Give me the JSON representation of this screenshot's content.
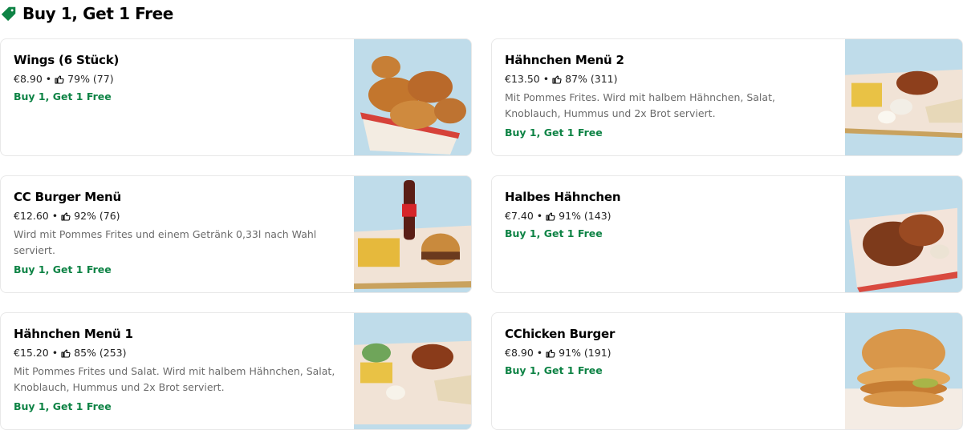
{
  "section": {
    "title": "Buy 1, Get 1 Free",
    "icon": "tag-icon",
    "accent": "#0e8345"
  },
  "items": [
    {
      "name": "Wings (6 Stück)",
      "price": "€8.90",
      "rating": "79% (77)",
      "description": "",
      "promo": "Buy 1, Get 1 Free",
      "image": "chicken-wings-photo"
    },
    {
      "name": "Hähnchen Menü 2",
      "price": "€13.50",
      "rating": "87% (311)",
      "description": "Mit Pommes Frites. Wird mit halbem Hähnchen, Salat, Knoblauch, Hummus und 2x Brot serviert.",
      "promo": "Buy 1, Get 1 Free",
      "image": "chicken-menu-photo"
    },
    {
      "name": "CC Burger Menü",
      "price": "€12.60",
      "rating": "92% (76)",
      "description": "Wird mit Pommes Frites und einem Getränk 0,33l nach Wahl serviert.",
      "promo": "Buy 1, Get 1 Free",
      "image": "burger-menu-photo"
    },
    {
      "name": "Halbes Hähnchen",
      "price": "€7.40",
      "rating": "91% (143)",
      "description": "",
      "promo": "Buy 1, Get 1 Free",
      "image": "half-chicken-photo"
    },
    {
      "name": "Hähnchen Menü 1",
      "price": "€15.20",
      "rating": "85% (253)",
      "description": "Mit Pommes Frites und Salat. Wird mit halbem Hähnchen, Salat, Knoblauch, Hummus und 2x Brot serviert.",
      "promo": "Buy 1, Get 1 Free",
      "image": "chicken-menu-photo"
    },
    {
      "name": "CChicken Burger",
      "price": "€8.90",
      "rating": "91% (191)",
      "description": "",
      "promo": "Buy 1, Get 1 Free",
      "image": "chicken-burger-photo"
    }
  ],
  "separator": "•"
}
